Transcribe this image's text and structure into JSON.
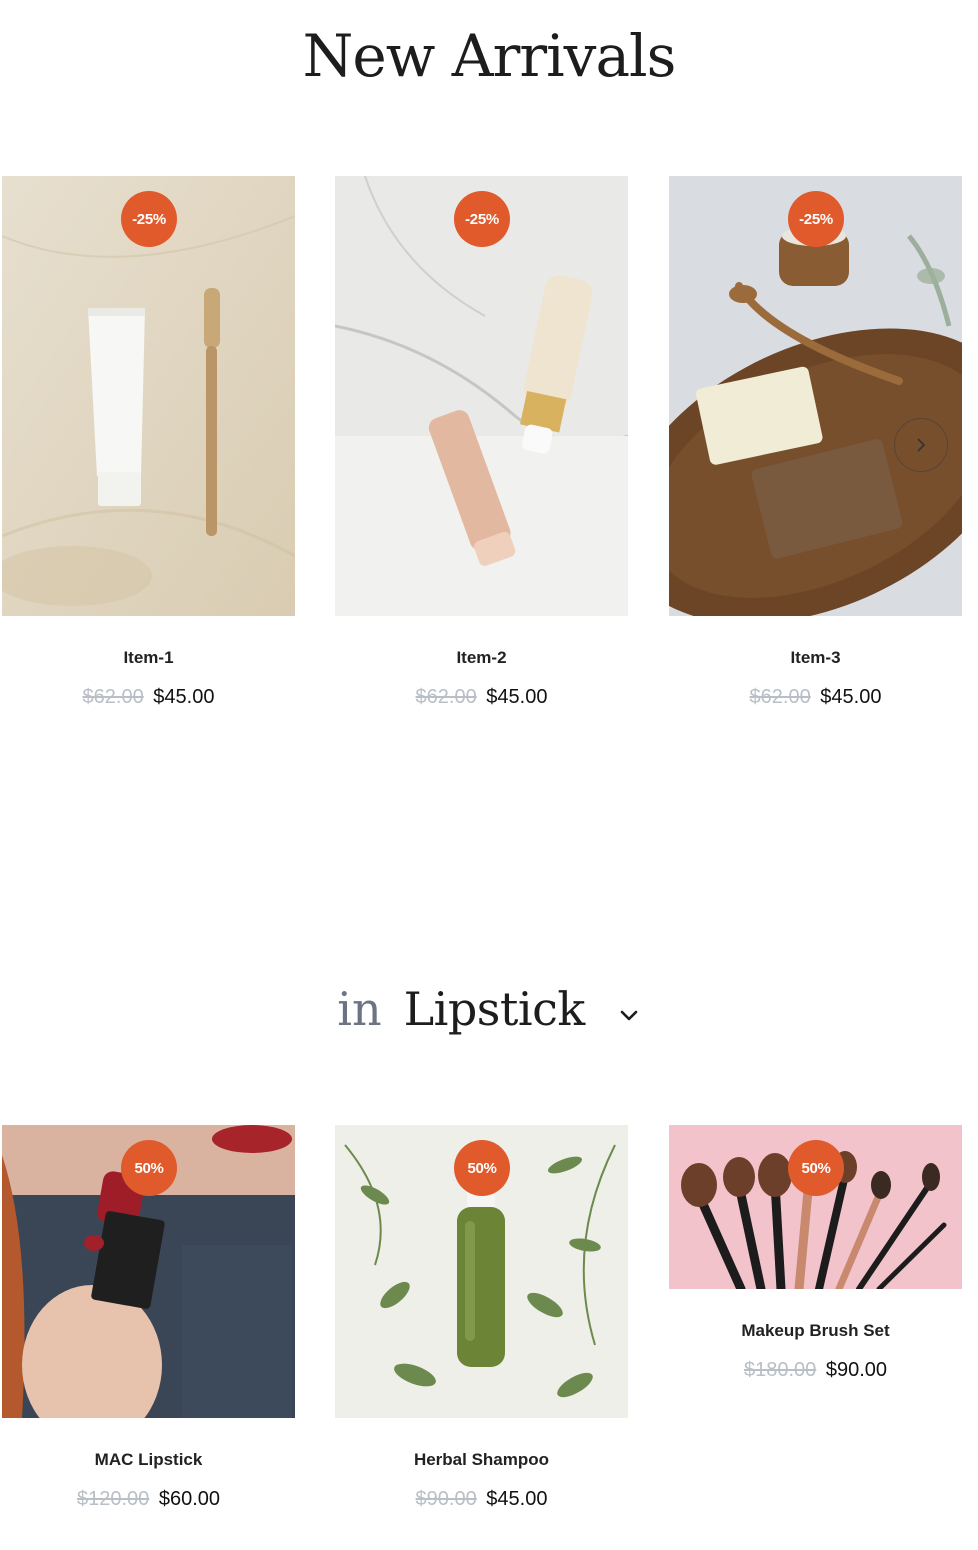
{
  "new_arrivals": {
    "title": "New Arrivals",
    "items": [
      {
        "badge": "-25%",
        "name": "Item-1",
        "old_price": "$62.00",
        "price": "$45.00"
      },
      {
        "badge": "-25%",
        "name": "Item-2",
        "old_price": "$62.00",
        "price": "$45.00"
      },
      {
        "badge": "-25%",
        "name": "Item-3",
        "old_price": "$62.00",
        "price": "$45.00"
      }
    ],
    "next_icon": "chevron-right-icon"
  },
  "category": {
    "prefix": "in",
    "selected": "Lipstick",
    "dropdown_icon": "chevron-down-icon",
    "items": [
      {
        "badge": "50%",
        "name": "MAC Lipstick",
        "old_price": "$120.00",
        "price": "$60.00"
      },
      {
        "badge": "50%",
        "name": "Herbal Shampoo",
        "old_price": "$90.00",
        "price": "$45.00"
      },
      {
        "badge": "50%",
        "name": "Makeup Brush Set",
        "old_price": "$180.00",
        "price": "$90.00"
      }
    ]
  },
  "colors": {
    "badge": "#e05a2b",
    "old_price": "#b9bfc6",
    "heading": "#1d1d1d",
    "muted_heading": "#6b7385"
  }
}
